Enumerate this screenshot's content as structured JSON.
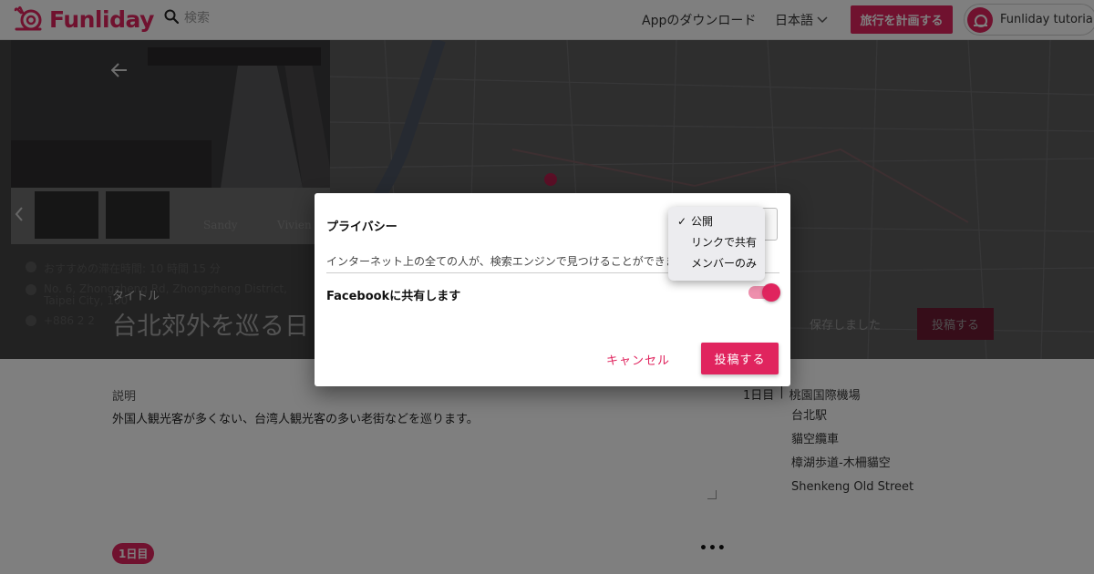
{
  "header": {
    "brand": "Funliday",
    "search_placeholder": "検索",
    "app_download": "Appのダウンロード",
    "language": "日本語",
    "plan_button": "旅行を計画する",
    "user_name": "Funliday tutorial"
  },
  "hero": {
    "photo_strip_labels": [
      "Sandy",
      "Vivien"
    ],
    "info": {
      "recommended_time": "おすすめの滞在時間: 10 時間 15 分",
      "address": "No. 6, Zhongzheng Rd, Zhongzheng District, Taipei City, 100",
      "phone": "+886 2 2"
    },
    "title_label": "タイトル",
    "title": "台北郊外を巡る日",
    "saved_status": "保存しました",
    "post_button": "投稿する"
  },
  "content": {
    "description_label": "説明",
    "description": "外国人観光客が多くない、台湾人観光客の多い老街などを巡ります。",
    "day_header": {
      "day": "1日目",
      "separator": "|",
      "first_stop": "桃園国際機場"
    },
    "stops": [
      "台北駅",
      "貓空纜車",
      "樟湖歩道-木柵貓空",
      "Shenkeng Old Street"
    ],
    "day_badge": "1日目",
    "more": "•••"
  },
  "modal": {
    "privacy_label": "プライバシー",
    "privacy_description": "インターネット上の全ての人が、検索エンジンで見つけることができます",
    "privacy_options": [
      {
        "label": "公開",
        "checked": true
      },
      {
        "label": "リンクで共有",
        "checked": false
      },
      {
        "label": "メンバーのみ",
        "checked": false
      }
    ],
    "check_mark": "✓",
    "facebook_label": "Facebookに共有します",
    "facebook_share_enabled": true,
    "cancel_button": "キャンセル",
    "post_button": "投稿する"
  },
  "colors": {
    "brand": "#e0245e",
    "toggle_track": "#ee8fad",
    "overlay": "rgba(0,0,0,0.5)"
  },
  "icons": [
    "funliday-logo-icon",
    "search-icon",
    "chevron-down-icon",
    "back-arrow-icon",
    "chevron-left-icon",
    "clock-icon",
    "location-pin-icon",
    "phone-icon",
    "resize-handle-icon",
    "more-icon"
  ]
}
